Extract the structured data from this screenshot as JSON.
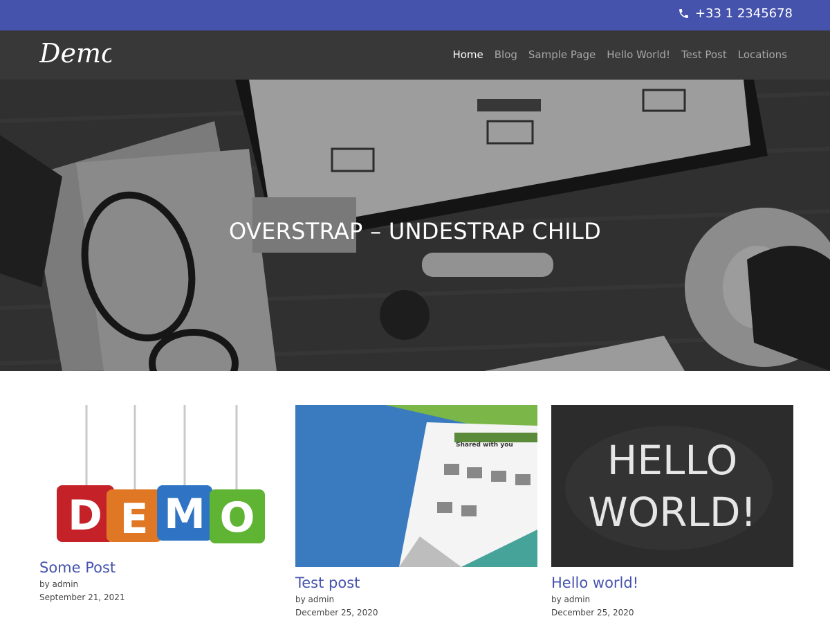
{
  "topbar": {
    "phone": "+33 1 2345678",
    "phone_icon": "phone-icon"
  },
  "navbar": {
    "logo_text": "Demo",
    "items": [
      {
        "label": "Home",
        "active": true
      },
      {
        "label": "Blog"
      },
      {
        "label": "Sample Page"
      },
      {
        "label": "Hello World!"
      },
      {
        "label": "Test Post"
      },
      {
        "label": "Locations"
      }
    ]
  },
  "hero": {
    "title": "OVERSTRAP – UNDESTRAP CHILD"
  },
  "posts": [
    {
      "title": "Some Post",
      "author": "by admin",
      "date": "September 21, 2021",
      "image_letters": [
        "D",
        "E",
        "M",
        "O"
      ]
    },
    {
      "title": "Test post",
      "author": "by admin",
      "date": "December 25, 2020",
      "image_text": "Shared with you"
    },
    {
      "title": "Hello world!",
      "author": "by admin",
      "date": "December 25, 2020",
      "image_text": [
        "HELLO",
        "WORLD!"
      ]
    }
  ],
  "colors": {
    "topbar": "#4553ad",
    "navbar": "#383838",
    "link": "#4553ad"
  }
}
